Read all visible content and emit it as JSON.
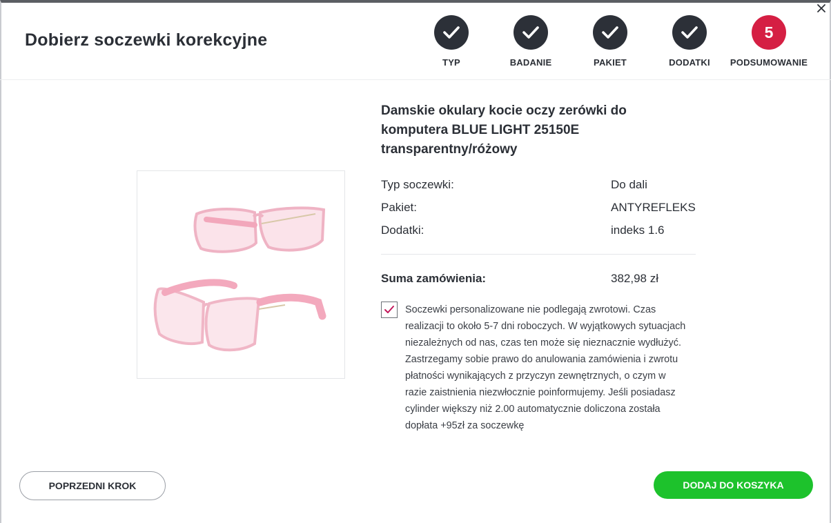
{
  "title": "Dobierz soczewki korekcyjne",
  "steps": [
    {
      "label": "TYP",
      "state": "done"
    },
    {
      "label": "BADANIE",
      "state": "done"
    },
    {
      "label": "PAKIET",
      "state": "done"
    },
    {
      "label": "DODATKI",
      "state": "done"
    },
    {
      "label": "PODSUMOWANIE",
      "state": "active",
      "number": "5"
    }
  ],
  "product": {
    "title": "Damskie okulary kocie oczy zerówki do komputera BLUE LIGHT 25150E transparentny/różowy",
    "image_icon": "pink-glasses-photo"
  },
  "summary": {
    "rows": [
      {
        "label": "Typ soczewki:",
        "value": "Do dali"
      },
      {
        "label": "Pakiet:",
        "value": "ANTYREFLEKS"
      },
      {
        "label": "Dodatki:",
        "value": "indeks 1.6"
      }
    ],
    "total_label": "Suma zamówienia:",
    "total_value": "382,98 zł"
  },
  "consent": {
    "checked": true,
    "text": "Soczewki personalizowane nie podlegają zwrotowi. Czas realizacji to około 5-7 dni roboczych. W wyjątkowych sytuacjach niezależnych od nas, czas ten może się nieznacznie wydłużyć. Zastrzegamy sobie prawo do anulowania zamówienia i zwrotu płatności wynikających z przyczyn zewnętrznych, o czym w razie zaistnienia niezwłocznie poinformujemy. Jeśli posiadasz cylinder większy niż 2.00 automatycznie doliczona została dopłata +95zł za soczewkę"
  },
  "buttons": {
    "prev": "POPRZEDNI KROK",
    "add": "DODAJ DO KOSZYKA"
  },
  "colors": {
    "step_done": "#2c3038",
    "step_active": "#d51f43",
    "add_button": "#1dc22c",
    "checkmark": "#c2185b"
  }
}
